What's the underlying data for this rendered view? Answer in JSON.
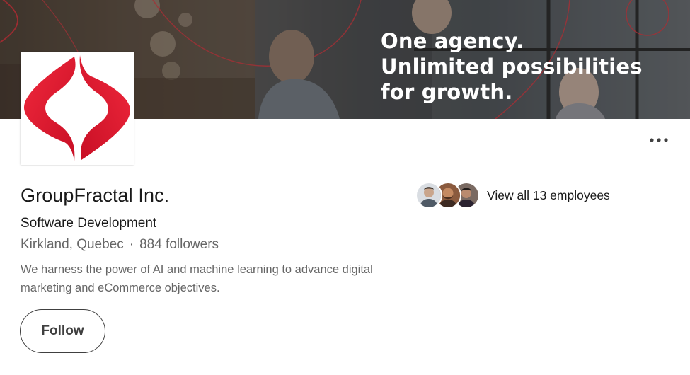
{
  "banner": {
    "tagline": [
      "One agency.",
      "Unlimited possibilities",
      "for growth."
    ]
  },
  "company": {
    "name": "GroupFractal Inc.",
    "industry": "Software Development",
    "location": "Kirkland, Quebec",
    "separator": "·",
    "followers": "884 followers",
    "description": "We harness the power of AI and machine learning to advance digital marketing and eCommerce objectives."
  },
  "actions": {
    "follow_label": "Follow",
    "more_icon": "ellipsis-icon"
  },
  "employees": {
    "label": "View all 13 employees",
    "avatar_count": 3
  },
  "colors": {
    "brand_red": "#e3122b",
    "text_primary": "#191919",
    "text_secondary": "#666666"
  }
}
